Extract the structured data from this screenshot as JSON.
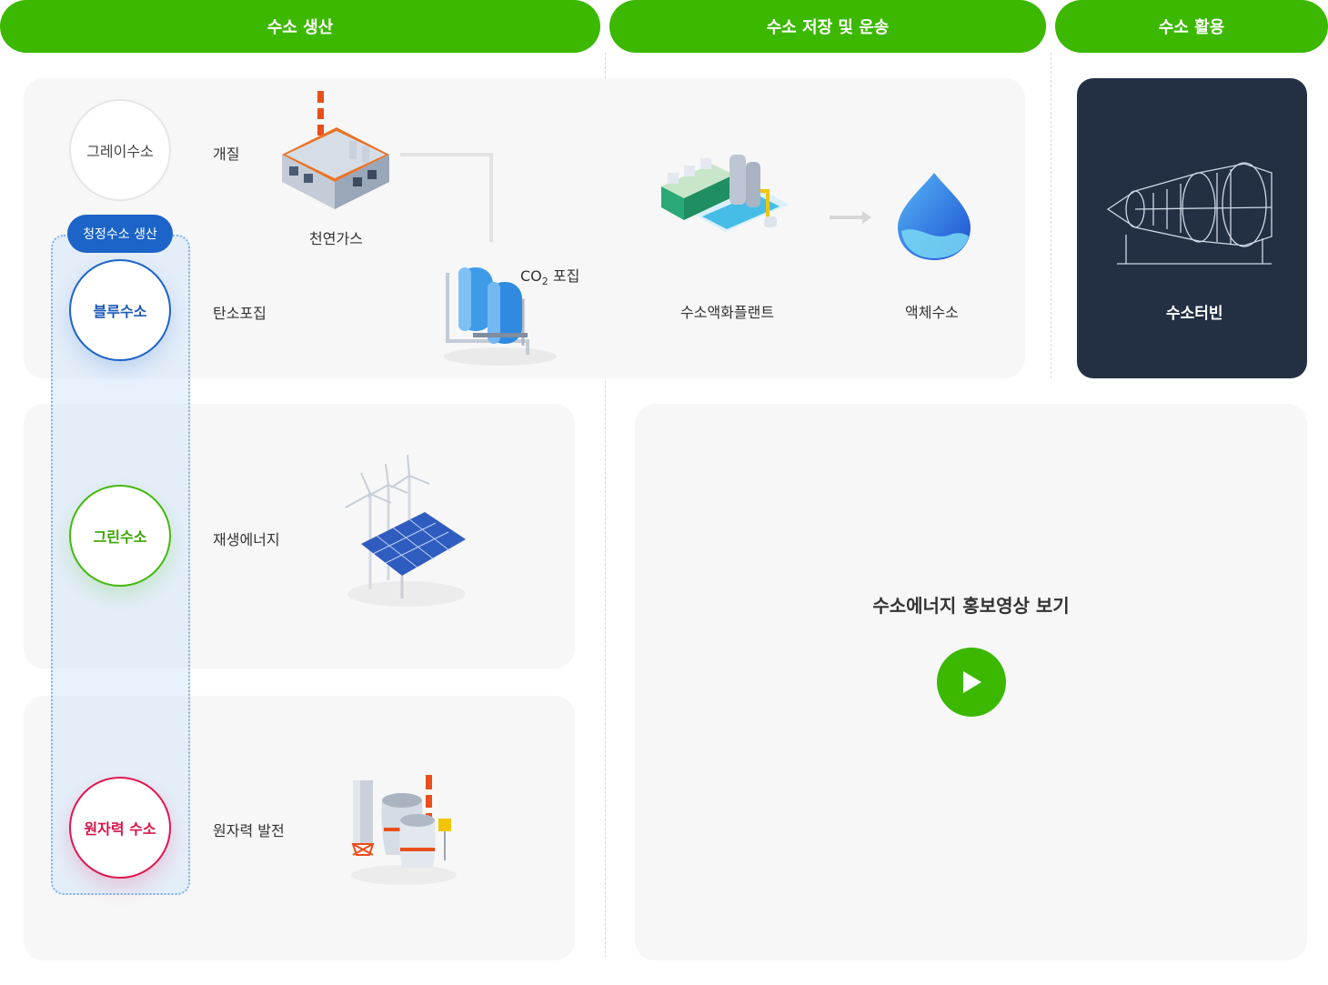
{
  "headers": {
    "production": "수소 생산",
    "storage": "수소 저장 및 운송",
    "utilization": "수소 활용"
  },
  "types": {
    "gray": "그레이수소",
    "blue": "블루수소",
    "green": "그린수소",
    "nuclear": "원자력 수소"
  },
  "clean_label": "청정수소 생산",
  "processes": {
    "reforming": "개질",
    "carbon_capture": "탄소포집",
    "renewable": "재생에너지",
    "nuclear_power": "원자력 발전"
  },
  "facilities": {
    "natural_gas": "천연가스",
    "co2_capture_prefix": "CO",
    "co2_capture_sub": "2",
    "co2_capture_suffix": " 포집",
    "liquefaction_plant": "수소액화플랜트",
    "liquid_hydrogen": "액체수소",
    "turbine": "수소터빈"
  },
  "video": {
    "title": "수소에너지 홍보영상 보기"
  },
  "colors": {
    "header_green": "#3cb800",
    "blue": "#1c64c8",
    "green": "#45b810",
    "red": "#e0174f",
    "dark_panel": "#233044"
  },
  "icons": [
    "factory-icon",
    "storage-tanks-icon",
    "liquefaction-plant-icon",
    "droplet-icon",
    "turbine-icon",
    "wind-solar-icon",
    "nuclear-plant-icon",
    "play-icon",
    "arrow-right-icon"
  ]
}
